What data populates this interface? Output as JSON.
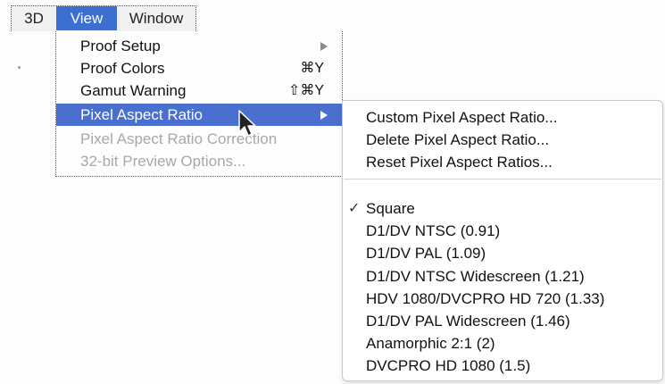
{
  "menubar": {
    "items": [
      {
        "label": "3D"
      },
      {
        "label": "View"
      },
      {
        "label": "Window"
      }
    ]
  },
  "view_menu": {
    "items": [
      {
        "label": "Proof Setup",
        "shortcut": "",
        "submenu": true,
        "state": "normal"
      },
      {
        "label": "Proof Colors",
        "shortcut": "⌘Y",
        "submenu": false,
        "state": "normal"
      },
      {
        "label": "Gamut Warning",
        "shortcut": "⇧⌘Y",
        "submenu": false,
        "state": "normal"
      },
      {
        "label": "Pixel Aspect Ratio",
        "shortcut": "",
        "submenu": true,
        "state": "highlighted"
      },
      {
        "label": "Pixel Aspect Ratio Correction",
        "shortcut": "",
        "submenu": false,
        "state": "disabled"
      },
      {
        "label": "32-bit Preview Options...",
        "shortcut": "",
        "submenu": false,
        "state": "disabled"
      }
    ]
  },
  "pixel_aspect_submenu": {
    "actions": [
      {
        "label": "Custom Pixel Aspect Ratio..."
      },
      {
        "label": "Delete Pixel Aspect Ratio..."
      },
      {
        "label": "Reset Pixel Aspect Ratios..."
      }
    ],
    "ratios": [
      {
        "label": "Square",
        "checked": true,
        "check_mark": "✓"
      },
      {
        "label": "D1/DV NTSC (0.91)",
        "checked": false
      },
      {
        "label": "D1/DV PAL (1.09)",
        "checked": false
      },
      {
        "label": "D1/DV NTSC Widescreen (1.21)",
        "checked": false
      },
      {
        "label": "HDV 1080/DVCPRO HD 720 (1.33)",
        "checked": false
      },
      {
        "label": "D1/DV PAL Widescreen (1.46)",
        "checked": false
      },
      {
        "label": "Anamorphic 2:1 (2)",
        "checked": false
      },
      {
        "label": "DVCPRO HD 1080 (1.5)",
        "checked": false
      }
    ]
  },
  "colors": {
    "highlight": "#4a6fce",
    "menubar_active": "#3d6fd1",
    "disabled_text": "#a8a8a8"
  }
}
